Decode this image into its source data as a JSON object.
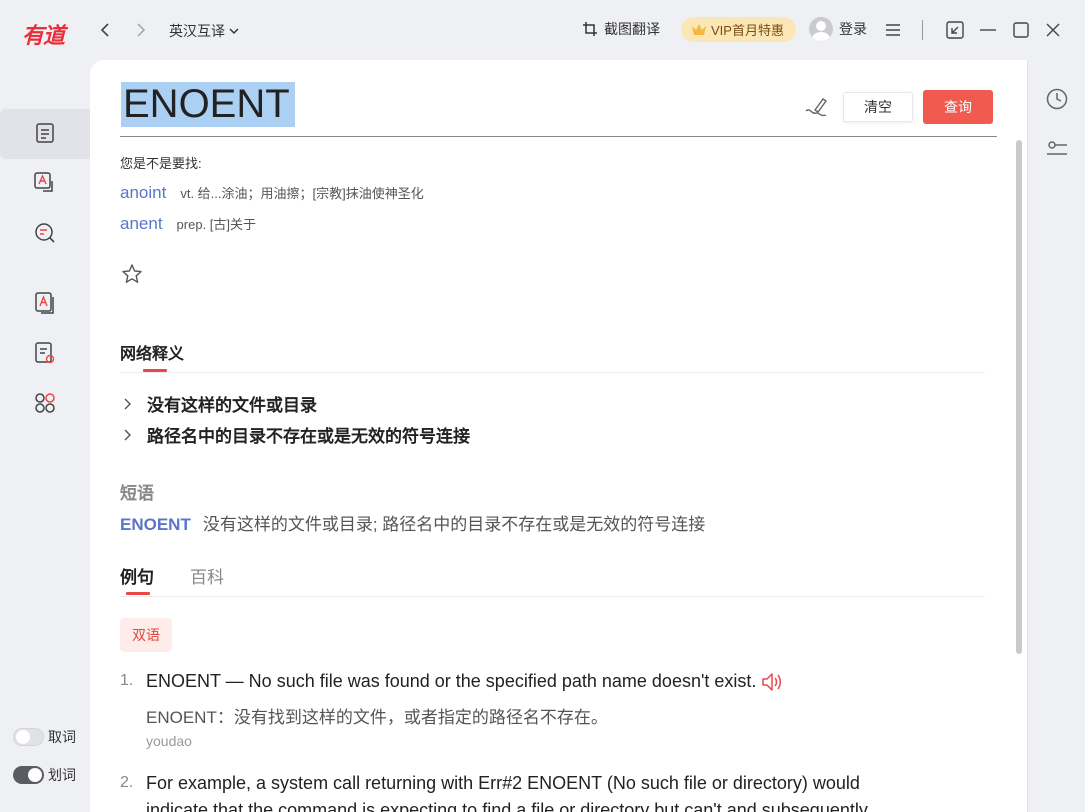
{
  "app": {
    "logo": "有道",
    "mode": "英汉互译",
    "screenshot_translate": "截图翻译",
    "vip": "VIP首月特惠",
    "login": "登录"
  },
  "search": {
    "word": "ENOENT",
    "clear_label": "清空",
    "query_label": "查询"
  },
  "suggest": {
    "title": "您是不是要找:",
    "items": [
      {
        "word": "anoint",
        "def": "vt. 给...涂油；用油擦；[宗教]抹油使神圣化"
      },
      {
        "word": "anent",
        "def": "prep. [古]关于"
      }
    ]
  },
  "web": {
    "title": "网络释义",
    "items": [
      "没有这样的文件或目录",
      "路径名中的目录不存在或是无效的符号连接"
    ]
  },
  "phrase": {
    "title": "短语",
    "word": "ENOENT",
    "def": "没有这样的文件或目录; 路径名中的目录不存在或是无效的符号连接"
  },
  "tabs": [
    "例句",
    "百科"
  ],
  "tag": "双语",
  "examples": [
    {
      "num": "1.",
      "en": "ENOENT — No such file was found or the specified path name doesn't exist.",
      "zh": "ENOENT：没有找到这样的文件，或者指定的路径名不存在。",
      "src": "youdao"
    },
    {
      "num": "2.",
      "en_line1": "For example, a system call returning with Err#2 ENOENT (No such file or directory) would",
      "en_line2": "indicate that the command is expecting to find a file or directory but can't and subsequently"
    }
  ],
  "toggles": [
    {
      "label": "取词",
      "state": "off"
    },
    {
      "label": "划词",
      "state": "on"
    }
  ]
}
